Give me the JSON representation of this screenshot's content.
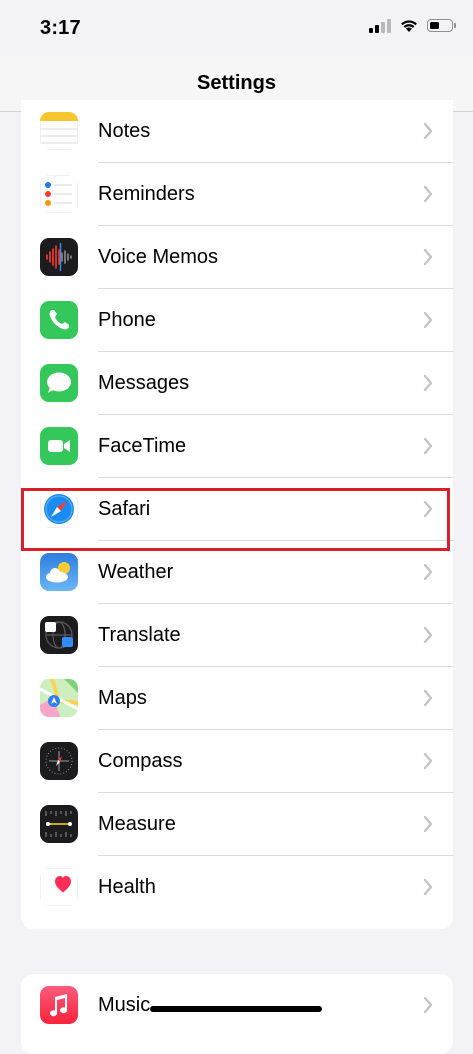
{
  "status_bar": {
    "time": "3:17",
    "icons": [
      "signal-icon",
      "wifi-icon",
      "battery-icon"
    ],
    "battery_level": 0.45
  },
  "nav": {
    "title": "Settings"
  },
  "settings": {
    "items": [
      {
        "label": "Notes",
        "icon": "notes-icon"
      },
      {
        "label": "Reminders",
        "icon": "reminders-icon"
      },
      {
        "label": "Voice Memos",
        "icon": "voice-memos-icon"
      },
      {
        "label": "Phone",
        "icon": "phone-icon"
      },
      {
        "label": "Messages",
        "icon": "messages-icon"
      },
      {
        "label": "FaceTime",
        "icon": "facetime-icon"
      },
      {
        "label": "Safari",
        "icon": "safari-icon",
        "highlighted": true
      },
      {
        "label": "Weather",
        "icon": "weather-icon"
      },
      {
        "label": "Translate",
        "icon": "translate-icon"
      },
      {
        "label": "Maps",
        "icon": "maps-icon"
      },
      {
        "label": "Compass",
        "icon": "compass-icon"
      },
      {
        "label": "Measure",
        "icon": "measure-icon"
      },
      {
        "label": "Health",
        "icon": "health-icon"
      }
    ],
    "next_group": [
      {
        "label": "Music",
        "icon": "music-icon"
      }
    ]
  },
  "colors": {
    "highlight": "#d8202a",
    "background": "#f2f2f7",
    "chevron": "#c4c4c7"
  }
}
